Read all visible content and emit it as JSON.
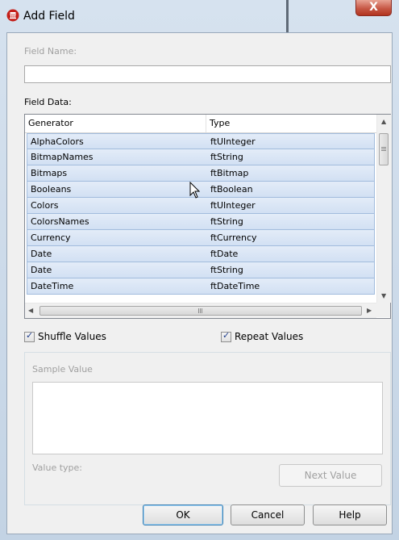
{
  "window": {
    "title": "Add Field",
    "close_glyph": "X",
    "app_icon": "database-icon"
  },
  "field_name": {
    "label": "Field Name:",
    "value": ""
  },
  "field_data": {
    "label": "Field Data:",
    "columns": [
      "Generator",
      "Type"
    ],
    "rows": [
      {
        "generator": "AlphaColors",
        "type": "ftUInteger"
      },
      {
        "generator": "BitmapNames",
        "type": "ftString"
      },
      {
        "generator": "Bitmaps",
        "type": "ftBitmap"
      },
      {
        "generator": "Booleans",
        "type": "ftBoolean"
      },
      {
        "generator": "Colors",
        "type": "ftUInteger"
      },
      {
        "generator": "ColorsNames",
        "type": "ftString"
      },
      {
        "generator": "Currency",
        "type": "ftCurrency"
      },
      {
        "generator": "Date",
        "type": "ftDate"
      },
      {
        "generator": "Date",
        "type": "ftString"
      },
      {
        "generator": "DateTime",
        "type": "ftDateTime"
      }
    ]
  },
  "options": {
    "shuffle": {
      "label": "Shuffle Values",
      "checked": true
    },
    "repeat": {
      "label": "Repeat Values",
      "checked": true
    }
  },
  "sample": {
    "label": "Sample Value",
    "value": "",
    "value_type_label": "Value type:",
    "next_button": "Next Value"
  },
  "buttons": {
    "ok": "OK",
    "cancel": "Cancel",
    "help": "Help"
  },
  "colors": {
    "row_selected": "#d6e4f6",
    "title_gradient_top": "#d6e2ef",
    "close_button": "#c75846"
  }
}
